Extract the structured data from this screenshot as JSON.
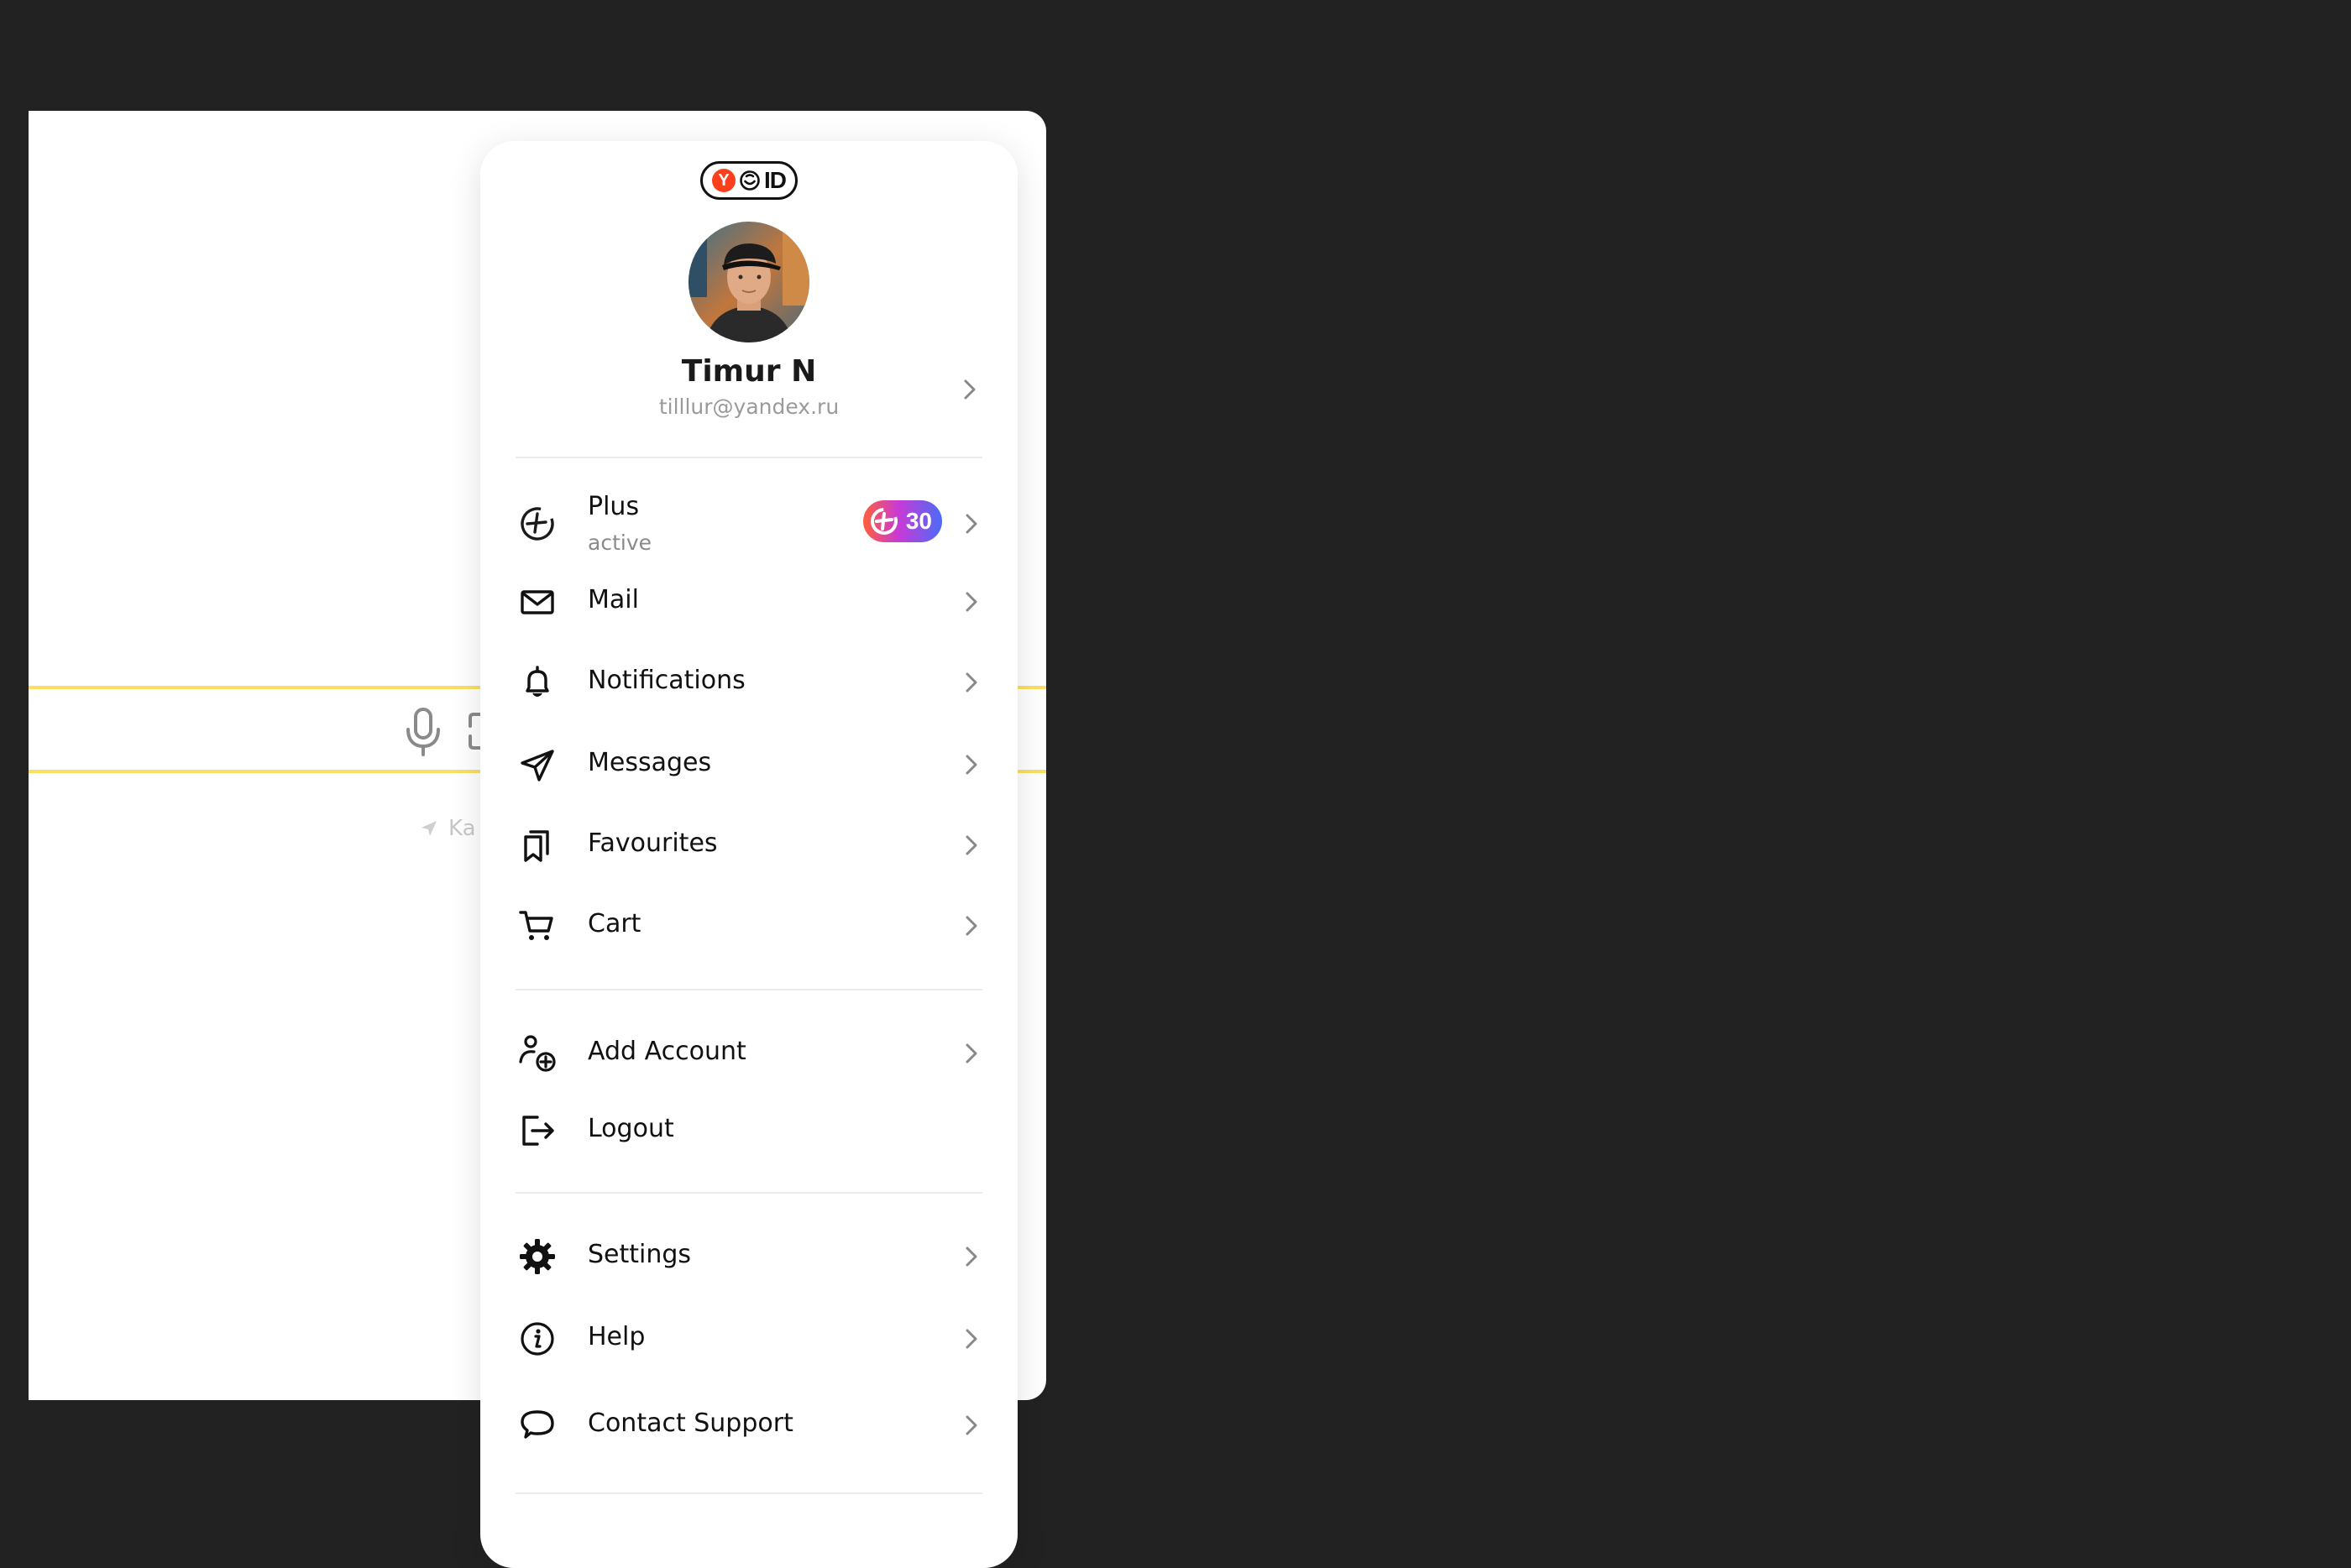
{
  "background": {
    "geo_hint": "Ka"
  },
  "panel": {
    "logo": {
      "y_letter": "Y",
      "id_text": "ID"
    },
    "profile": {
      "name": "Timur N",
      "email": "tilllur@yandex.ru"
    },
    "plus": {
      "label": "Plus",
      "status": "active",
      "badge_value": "30"
    },
    "menu_group_1": [
      {
        "label": "Mail",
        "icon": "mail-icon"
      },
      {
        "label": "Notifications",
        "icon": "bell-icon"
      },
      {
        "label": "Messages",
        "icon": "send-icon"
      },
      {
        "label": "Favourites",
        "icon": "bookmarks-icon"
      },
      {
        "label": "Cart",
        "icon": "cart-icon"
      }
    ],
    "menu_group_2": [
      {
        "label": "Add Account",
        "icon": "add-user-icon"
      },
      {
        "label": "Logout",
        "icon": "logout-icon"
      }
    ],
    "menu_group_3": [
      {
        "label": "Settings",
        "icon": "gear-icon"
      },
      {
        "label": "Help",
        "icon": "info-icon"
      },
      {
        "label": "Contact Support",
        "icon": "chat-bubble-icon"
      }
    ]
  },
  "colors": {
    "backdrop": "#222222",
    "search_border": "#fadf63",
    "yandex_red": "#fc3f1d"
  }
}
